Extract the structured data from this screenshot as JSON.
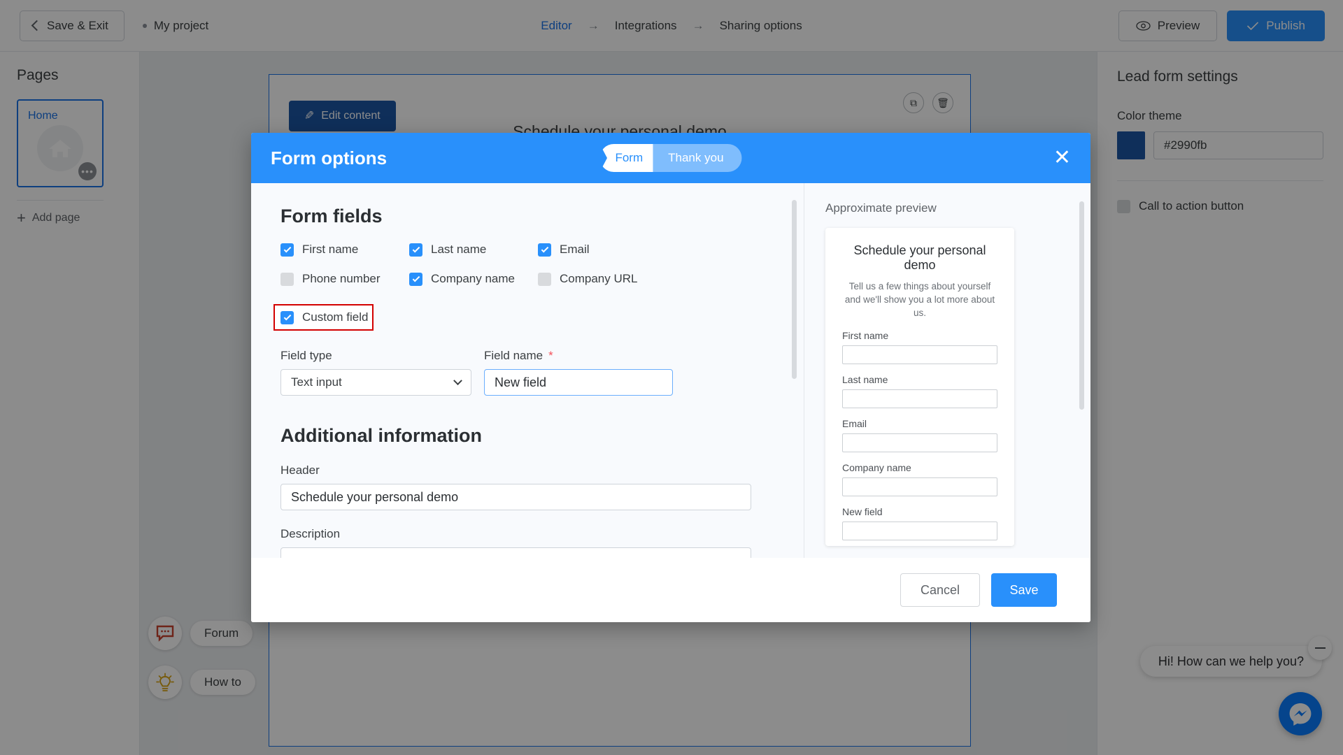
{
  "topbar": {
    "save_exit": "Save & Exit",
    "project_name": "My project",
    "breadcrumb": [
      {
        "label": "Editor",
        "active": true
      },
      {
        "label": "Integrations",
        "active": false
      },
      {
        "label": "Sharing options",
        "active": false
      }
    ],
    "arrow": "→",
    "preview": "Preview",
    "publish": "Publish"
  },
  "left_sidebar": {
    "title": "Pages",
    "page_card": {
      "label": "Home",
      "menu": "•••"
    },
    "add_page": "Add page",
    "plus": "+"
  },
  "canvas": {
    "edit_content": "Edit content",
    "section_heading": "Schedule your personal demo",
    "tool_duplicate": "⧉",
    "tool_delete": "🗑"
  },
  "right_sidebar": {
    "title": "Lead form settings",
    "color_theme_label": "Color theme",
    "color_value": "#2990fb",
    "color_swatch": "#1c56a5",
    "cta_label": "Call to action button"
  },
  "helpers": [
    {
      "label": "Forum",
      "icon": "chat-icon"
    },
    {
      "label": "How to",
      "icon": "lightbulb-icon"
    }
  ],
  "chat": {
    "message": "Hi! How can we help you?",
    "minimize": "—"
  },
  "modal": {
    "title": "Form options",
    "close": "✕",
    "tabs": [
      {
        "label": "Form",
        "active": true
      },
      {
        "label": "Thank you",
        "active": false
      }
    ],
    "form_fields": {
      "section_title": "Form fields",
      "checkboxes": [
        {
          "label": "First name",
          "checked": true,
          "highlighted": false
        },
        {
          "label": "Last name",
          "checked": true,
          "highlighted": false
        },
        {
          "label": "Email",
          "checked": true,
          "highlighted": false
        },
        {
          "label": "Phone number",
          "checked": false,
          "highlighted": false
        },
        {
          "label": "Company name",
          "checked": true,
          "highlighted": false
        },
        {
          "label": "Company URL",
          "checked": false,
          "highlighted": false
        },
        {
          "label": "Custom field",
          "checked": true,
          "highlighted": true
        }
      ],
      "field_type_label": "Field type",
      "field_type_value": "Text input",
      "field_name_label": "Field name",
      "field_name_required": "*",
      "field_name_value": "New field"
    },
    "additional_information": {
      "section_title": "Additional information",
      "header_label": "Header",
      "header_value": "Schedule your personal demo",
      "description_label": "Description"
    },
    "preview": {
      "label": "Approximate preview",
      "title": "Schedule your personal demo",
      "subtitle": "Tell us a few things about yourself and we'll show you a lot more about us.",
      "fields": [
        {
          "label": "First name"
        },
        {
          "label": "Last name"
        },
        {
          "label": "Email"
        },
        {
          "label": "Company name"
        },
        {
          "label": "New field"
        }
      ]
    },
    "footer": {
      "cancel": "Cancel",
      "save": "Save"
    }
  }
}
